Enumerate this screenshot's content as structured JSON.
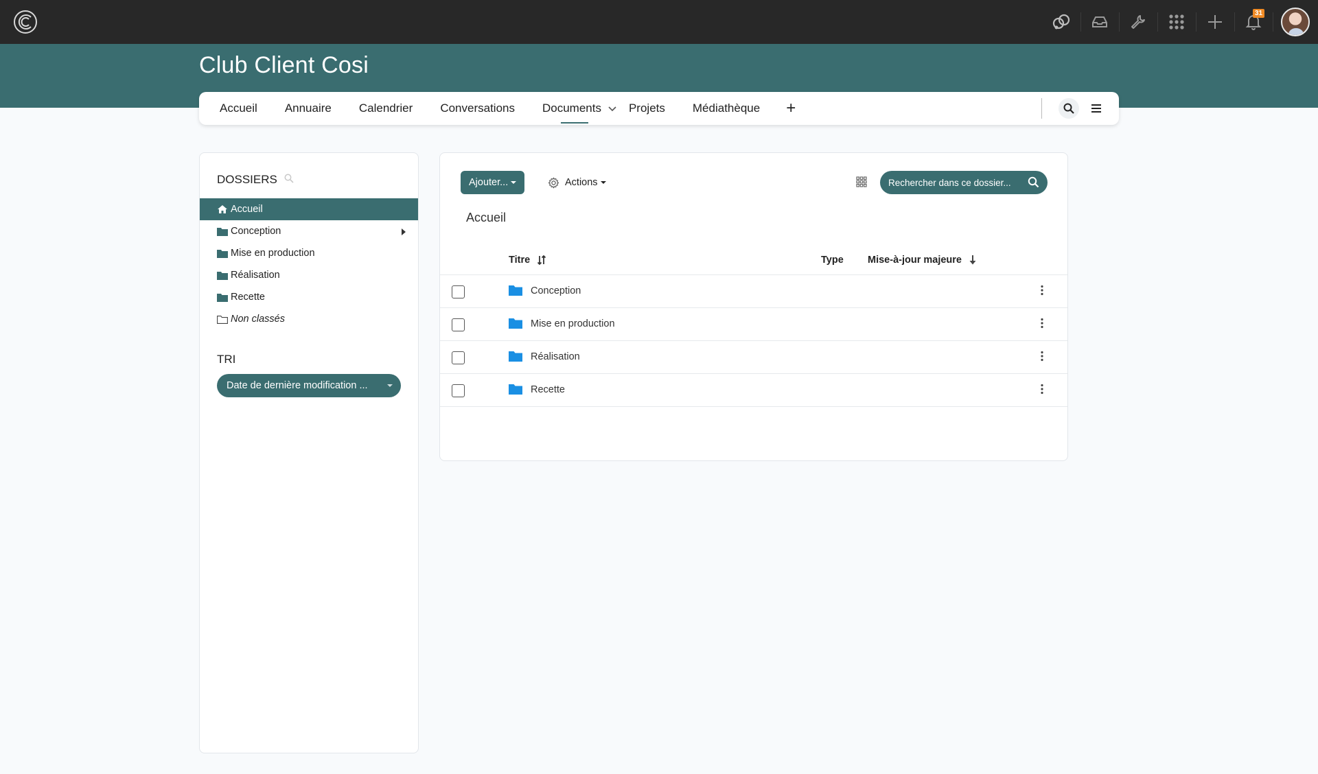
{
  "topbar": {
    "icons": [
      "chat-icon",
      "inbox-icon",
      "tools-icon",
      "apps-grid-icon",
      "plus-icon",
      "bell-icon"
    ],
    "notification_count": "31"
  },
  "space": {
    "title": "Club Client Cosi"
  },
  "nav": {
    "items": [
      {
        "label": "Accueil"
      },
      {
        "label": "Annuaire"
      },
      {
        "label": "Calendrier"
      },
      {
        "label": "Conversations"
      },
      {
        "label": "Documents"
      },
      {
        "label": "Projets"
      },
      {
        "label": "Médiathèque"
      }
    ],
    "plus_label": "+"
  },
  "sidebar": {
    "folders_heading": "DOSSIERS",
    "folders": [
      {
        "label": "Accueil"
      },
      {
        "label": "Conception"
      },
      {
        "label": "Mise en production"
      },
      {
        "label": "Réalisation"
      },
      {
        "label": "Recette"
      },
      {
        "label": "Non classés"
      }
    ],
    "sort_heading": "TRI",
    "sort_value": "Date de dernière modification ..."
  },
  "main": {
    "add_label": "Ajouter...",
    "actions_label": "Actions",
    "search_placeholder": "Rechercher dans ce dossier...",
    "current_folder": "Accueil",
    "columns": {
      "title": "Titre",
      "type": "Type",
      "updated": "Mise-à-jour majeure"
    },
    "rows": [
      {
        "name": "Conception"
      },
      {
        "name": "Mise en production"
      },
      {
        "name": "Réalisation"
      },
      {
        "name": "Recette"
      }
    ]
  },
  "colors": {
    "accent": "#3a6d70",
    "topbar": "#282828",
    "folder_blue": "#1a8fe3",
    "badge": "#f08a24"
  }
}
